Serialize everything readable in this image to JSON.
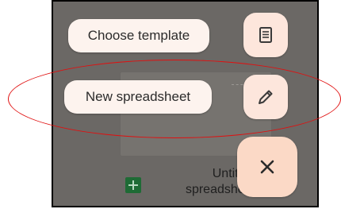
{
  "menu": {
    "choose_template_label": "Choose template",
    "new_spreadsheet_label": "New spreadsheet"
  },
  "file": {
    "title": "Untitled\nspreadsheet"
  },
  "icons": {
    "template": "document-template-icon",
    "new": "pencil-icon",
    "close": "close-icon",
    "file_type": "sheets-icon"
  },
  "colors": {
    "scrim": "#6b6865",
    "pill_bg": "#fdf3ee",
    "fab_bg": "#fde6dc",
    "close_bg": "#fbd9c6",
    "annotation": "#e01010"
  }
}
